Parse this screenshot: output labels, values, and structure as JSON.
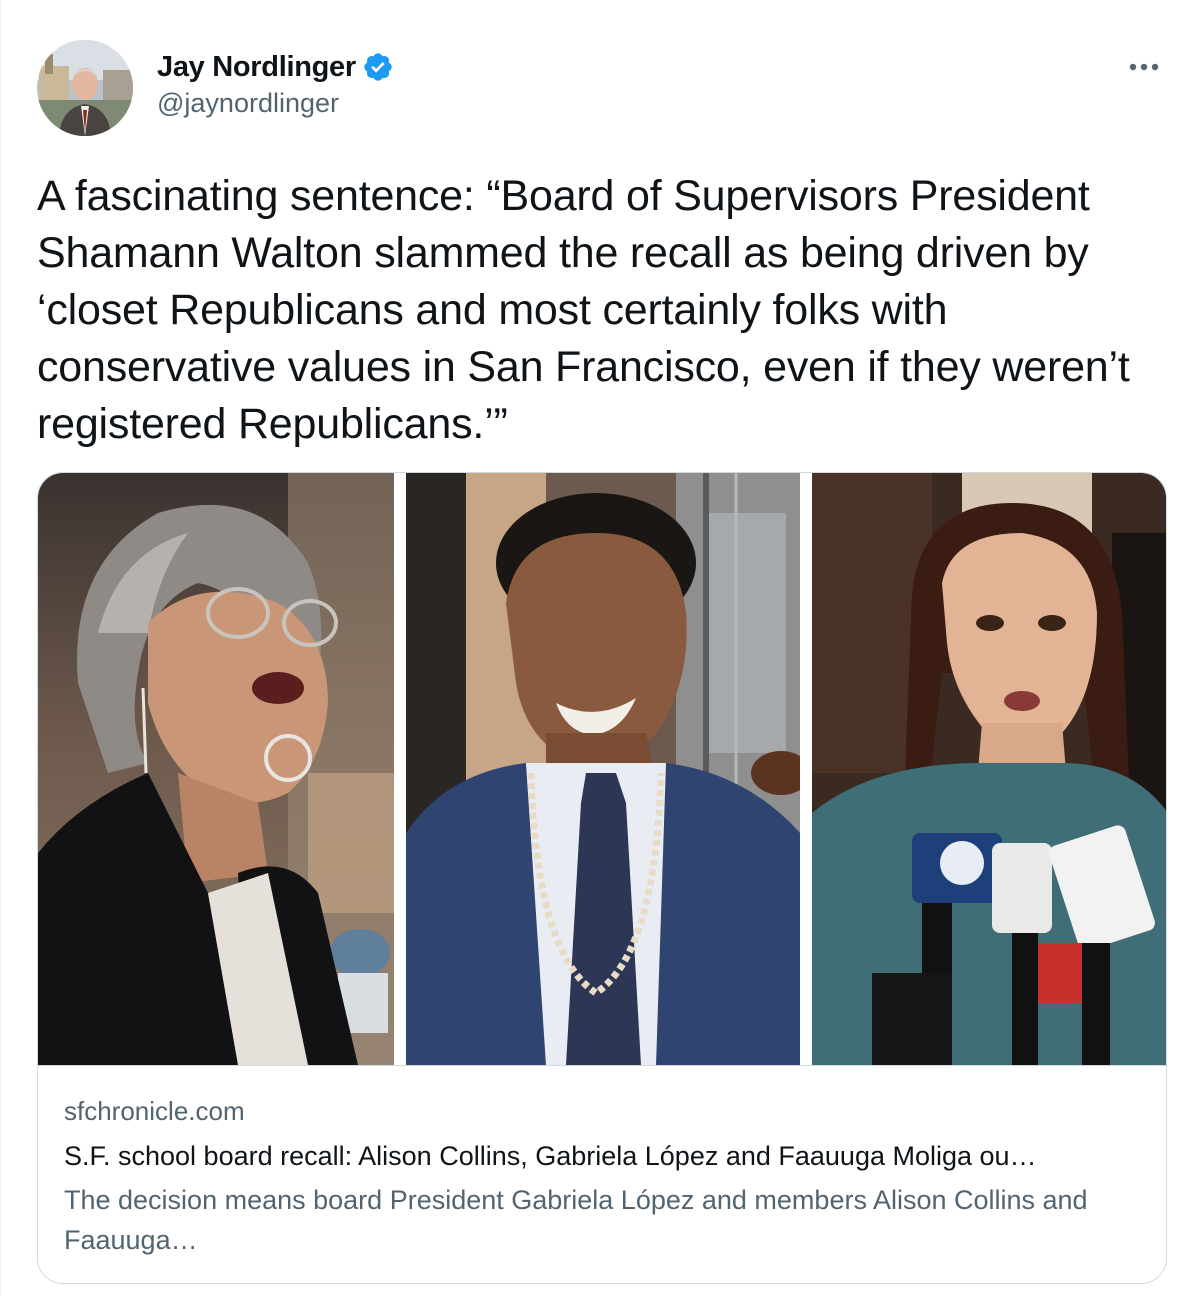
{
  "tweet": {
    "author": {
      "display_name": "Jay Nordlinger",
      "handle": "@jaynordlinger",
      "verified": true
    },
    "text": "A fascinating sentence: “Board of Supervisors President Shamann Walton slammed the recall as being driven by ‘closet Republicans and most certainly folks with conservative values in San Francisco, even if they weren’t registered Republicans.’”",
    "more_icon": "more-horizontal-icon"
  },
  "card": {
    "domain": "sfchronicle.com",
    "title": "S.F. school board recall: Alison Collins, Gabriela López and Faauuga Moliga ou…",
    "description": "The decision means board President Gabriela López and members Alison Collins and Faauuga…"
  },
  "colors": {
    "text_primary": "#0f1419",
    "text_secondary": "#536471",
    "verified_blue": "#1d9bf0",
    "border": "#cfd9de"
  }
}
